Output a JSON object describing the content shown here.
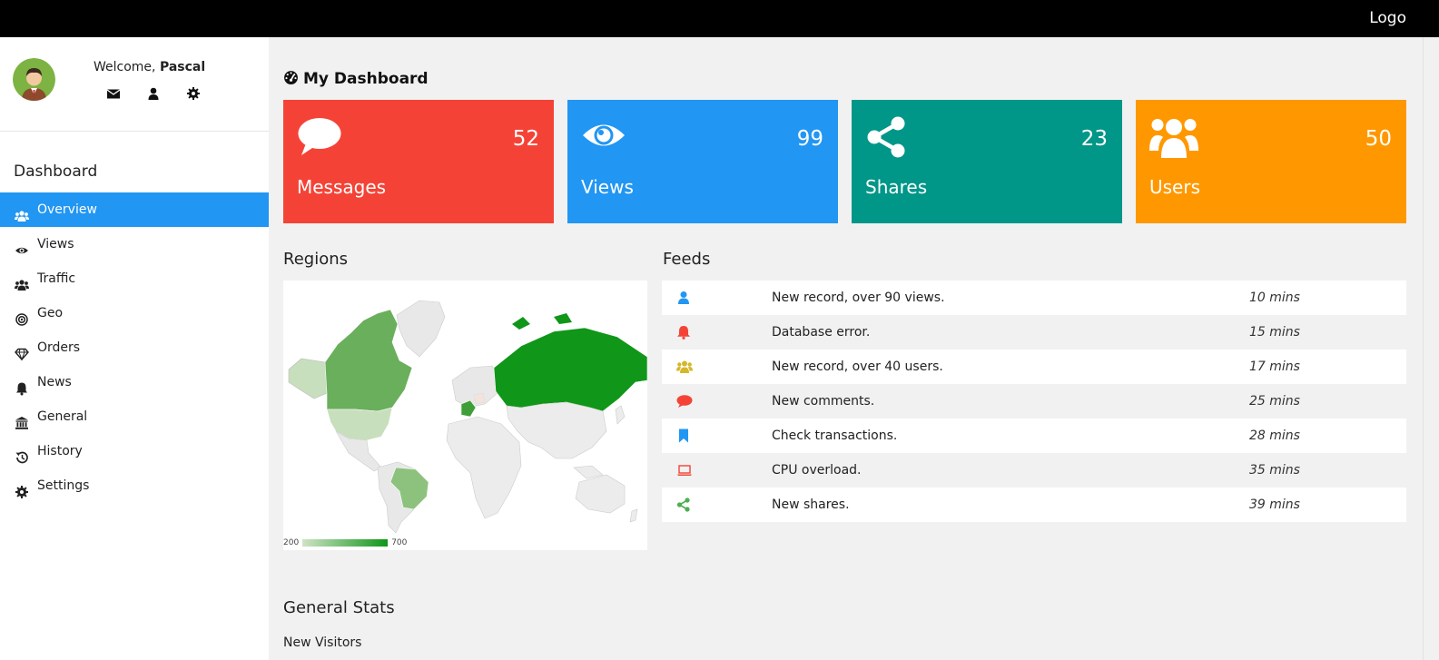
{
  "header": {
    "logo": "Logo"
  },
  "profile": {
    "welcome": "Welcome,",
    "name": "Pascal",
    "icons": [
      "envelope-icon",
      "user-icon",
      "gear-icon"
    ]
  },
  "sidebar": {
    "title": "Dashboard",
    "items": [
      {
        "label": "Overview",
        "icon": "users-icon",
        "active": true
      },
      {
        "label": "Views",
        "icon": "eye-icon"
      },
      {
        "label": "Traffic",
        "icon": "users-icon"
      },
      {
        "label": "Geo",
        "icon": "target-icon"
      },
      {
        "label": "Orders",
        "icon": "diamond-icon"
      },
      {
        "label": "News",
        "icon": "bell-icon"
      },
      {
        "label": "General",
        "icon": "bank-icon"
      },
      {
        "label": "History",
        "icon": "history-icon"
      },
      {
        "label": "Settings",
        "icon": "gear-icon"
      }
    ]
  },
  "main": {
    "title": "My Dashboard",
    "stats": [
      {
        "label": "Messages",
        "value": "52",
        "color": "#f44336",
        "icon": "comment-icon"
      },
      {
        "label": "Views",
        "value": "99",
        "color": "#2196f3",
        "icon": "eye-icon"
      },
      {
        "label": "Shares",
        "value": "23",
        "color": "#009688",
        "icon": "share-icon"
      },
      {
        "label": "Users",
        "value": "50",
        "color": "#ff9800",
        "icon": "users-icon"
      }
    ],
    "regions": {
      "title": "Regions",
      "legend_min": "200",
      "legend_max": "700"
    },
    "feeds": {
      "title": "Feeds",
      "rows": [
        {
          "icon": "user-icon",
          "color": "#2196f3",
          "text": "New record, over 90 views.",
          "time": "10 mins"
        },
        {
          "icon": "bell-icon",
          "color": "#f44336",
          "text": "Database error.",
          "time": "15 mins"
        },
        {
          "icon": "users-icon",
          "color": "#d4b82a",
          "text": "New record, over 40 users.",
          "time": "17 mins"
        },
        {
          "icon": "comment-icon",
          "color": "#f44336",
          "text": "New comments.",
          "time": "25 mins"
        },
        {
          "icon": "bookmark-icon",
          "color": "#2196f3",
          "text": "Check transactions.",
          "time": "28 mins"
        },
        {
          "icon": "laptop-icon",
          "color": "#f44336",
          "text": "CPU overload.",
          "time": "35 mins"
        },
        {
          "icon": "share-icon",
          "color": "#4caf50",
          "text": "New shares.",
          "time": "39 mins"
        }
      ]
    },
    "general_stats": {
      "title": "General Stats",
      "subtitle": "New Visitors"
    }
  }
}
